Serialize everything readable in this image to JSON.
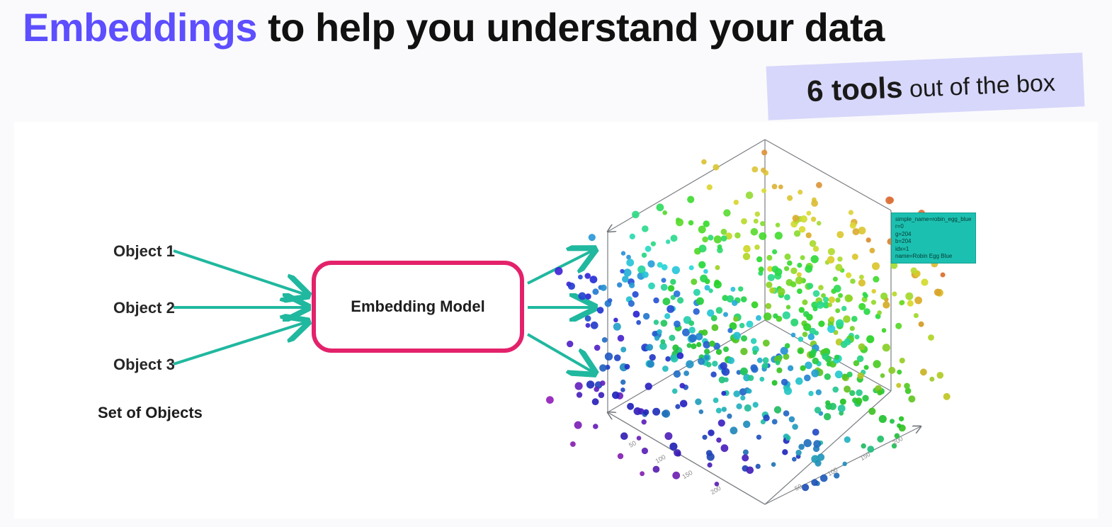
{
  "title": {
    "accent": "Embeddings",
    "rest": " to help you understand your data"
  },
  "note": {
    "big": "6 tools",
    "rest": " out of the box"
  },
  "diagram": {
    "object1": "Object 1",
    "object2": "Object 2",
    "object3": "Object 3",
    "set_label": "Set of Objects",
    "model_label": "Embedding Model"
  },
  "tooltip": {
    "line1": "simple_name=robin_egg_blue",
    "line2": "r=0",
    "line3": "g=204",
    "line4": "b=204",
    "line5": "idx=1",
    "line6": "name=Robin Egg Blue"
  },
  "axis_ticks": [
    "50",
    "100",
    "150",
    "200"
  ],
  "scatter_colors": "rainbow"
}
